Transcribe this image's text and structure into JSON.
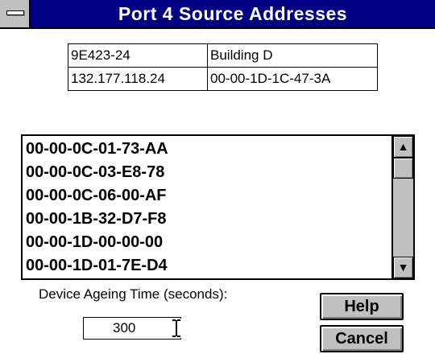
{
  "window": {
    "title": "Port 4 Source Addresses"
  },
  "info_table": {
    "rows": [
      [
        "9E423-24",
        "Building D"
      ],
      [
        "132.177.118.24",
        "00-00-1D-1C-47-3A"
      ]
    ]
  },
  "address_list": {
    "items": [
      "00-00-0C-01-73-AA",
      "00-00-0C-03-E8-78",
      "00-00-0C-06-00-AF",
      "00-00-1B-32-D7-F8",
      "00-00-1D-00-00-00",
      "00-00-1D-01-7E-D4"
    ],
    "scroll_up_glyph": "▲",
    "scroll_down_glyph": "▼"
  },
  "ageing": {
    "label": "Device Ageing Time (seconds):",
    "value": "300"
  },
  "buttons": {
    "help": "Help",
    "cancel": "Cancel"
  },
  "icons": {
    "system_menu": "system-menu-icon",
    "text_cursor": "i-beam-cursor-icon"
  }
}
